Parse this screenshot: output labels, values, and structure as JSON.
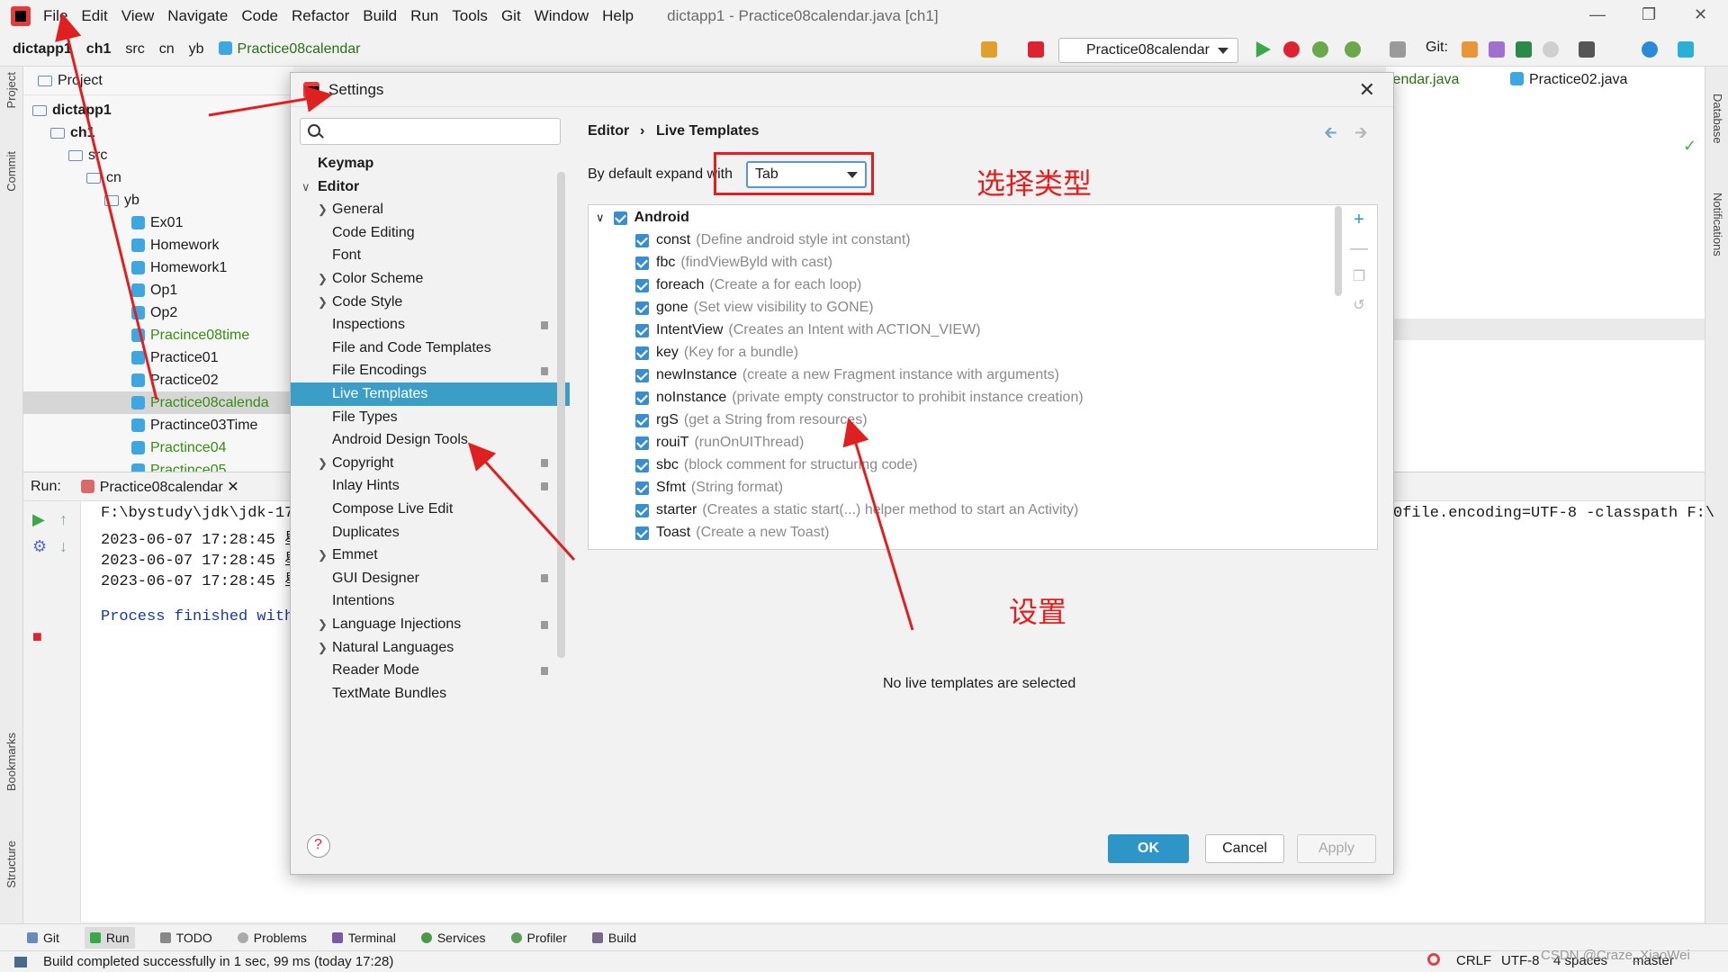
{
  "menubar": {
    "items": [
      "File",
      "Edit",
      "View",
      "Navigate",
      "Code",
      "Refactor",
      "Build",
      "Run",
      "Tools",
      "Git",
      "Window",
      "Help"
    ],
    "title": "dictapp1 - Practice08calendar.java [ch1]"
  },
  "navbar": {
    "crumbs": [
      "dictapp1",
      "ch1",
      "src",
      "cn",
      "yb"
    ],
    "file": "Practice08calendar",
    "run_config": "Practice08calendar",
    "git_label": "Git:"
  },
  "editor_tabs": {
    "tab1": "lendar.java",
    "tab2": "Practice02.java"
  },
  "side_labels": {
    "project": "Project",
    "commit": "Commit",
    "bookmarks": "Bookmarks",
    "structure": "Structure",
    "database": "Database",
    "notifications": "Notifications"
  },
  "project": {
    "header": "Project",
    "tree": [
      {
        "label": "dictapp1",
        "kind": "folder",
        "bold": true
      },
      {
        "label": "ch1",
        "kind": "folder",
        "bold": true
      },
      {
        "label": "src",
        "kind": "folder"
      },
      {
        "label": "cn",
        "kind": "folder"
      },
      {
        "label": "yb",
        "kind": "folder"
      },
      {
        "label": "Ex01",
        "kind": "class"
      },
      {
        "label": "Homework",
        "kind": "class"
      },
      {
        "label": "Homework1",
        "kind": "class"
      },
      {
        "label": "Op1",
        "kind": "class"
      },
      {
        "label": "Op2",
        "kind": "class"
      },
      {
        "label": "Pracince08time",
        "kind": "class",
        "green": true
      },
      {
        "label": "Practice01",
        "kind": "class"
      },
      {
        "label": "Practice02",
        "kind": "class"
      },
      {
        "label": "Practice08calenda",
        "kind": "class",
        "green": true
      },
      {
        "label": "Practince03Time",
        "kind": "class"
      },
      {
        "label": "Practince04",
        "kind": "class",
        "green": true
      },
      {
        "label": "Practince05",
        "kind": "class",
        "green": true
      }
    ]
  },
  "run": {
    "label": "Run:",
    "tab": "Practice08calendar",
    "lines": [
      "F:\\bystudy\\jdk\\jdk-17",
      "2023-06-07 17:28:45 星",
      "2023-06-07 17:28:45 星",
      "2023-06-07 17:28:45 星",
      "",
      "Process finished with"
    ],
    "right_line": "0file.encoding=UTF-8 -classpath F:\\"
  },
  "bottom_tabs": [
    "Git",
    "Run",
    "TODO",
    "Problems",
    "Terminal",
    "Services",
    "Profiler",
    "Build"
  ],
  "status": {
    "message": "Build completed successfully in 1 sec, 99 ms (today 17:28)",
    "line_sep": "CRLF",
    "encoding": "UTF-8",
    "indent": "4 spaces",
    "branch": "master",
    "watermark": "CSDN @Craze_XiaoWei"
  },
  "dialog": {
    "title": "Settings",
    "breadcrumb_parent": "Editor",
    "breadcrumb_sep": "›",
    "breadcrumb_current": "Live Templates",
    "expand_label": "By default expand with",
    "expand_value": "Tab",
    "no_selection": "No live templates are selected",
    "ok": "OK",
    "cancel": "Cancel",
    "apply": "Apply"
  },
  "settings_nav": [
    {
      "label": "Keymap",
      "level": 0,
      "bold": true
    },
    {
      "label": "Editor",
      "level": 0,
      "bold": true,
      "expanded": true
    },
    {
      "label": "General",
      "level": 1,
      "chevron": true
    },
    {
      "label": "Code Editing",
      "level": 1
    },
    {
      "label": "Font",
      "level": 1
    },
    {
      "label": "Color Scheme",
      "level": 1,
      "chevron": true
    },
    {
      "label": "Code Style",
      "level": 1,
      "chevron": true
    },
    {
      "label": "Inspections",
      "level": 1,
      "badge": true
    },
    {
      "label": "File and Code Templates",
      "level": 1
    },
    {
      "label": "File Encodings",
      "level": 1,
      "badge": true
    },
    {
      "label": "Live Templates",
      "level": 1,
      "selected": true
    },
    {
      "label": "File Types",
      "level": 1
    },
    {
      "label": "Android Design Tools",
      "level": 1
    },
    {
      "label": "Copyright",
      "level": 1,
      "chevron": true,
      "badge": true
    },
    {
      "label": "Inlay Hints",
      "level": 1,
      "badge": true
    },
    {
      "label": "Compose Live Edit",
      "level": 1
    },
    {
      "label": "Duplicates",
      "level": 1
    },
    {
      "label": "Emmet",
      "level": 1,
      "chevron": true
    },
    {
      "label": "GUI Designer",
      "level": 1,
      "badge": true
    },
    {
      "label": "Intentions",
      "level": 1
    },
    {
      "label": "Language Injections",
      "level": 1,
      "chevron": true,
      "badge": true
    },
    {
      "label": "Natural Languages",
      "level": 1,
      "chevron": true
    },
    {
      "label": "Reader Mode",
      "level": 1,
      "badge": true
    },
    {
      "label": "TextMate Bundles",
      "level": 1
    }
  ],
  "templates": {
    "group": "Android",
    "items": [
      {
        "name": "const",
        "desc": "(Define android style int constant)"
      },
      {
        "name": "fbc",
        "desc": "(findViewByld with cast)"
      },
      {
        "name": "foreach",
        "desc": "(Create a for each loop)"
      },
      {
        "name": "gone",
        "desc": "(Set view visibility to GONE)"
      },
      {
        "name": "IntentView",
        "desc": "(Creates an Intent with ACTION_VIEW)"
      },
      {
        "name": "key",
        "desc": "(Key for a bundle)"
      },
      {
        "name": "newInstance",
        "desc": "(create a new Fragment instance with arguments)"
      },
      {
        "name": "noInstance",
        "desc": "(private empty constructor to prohibit instance creation)"
      },
      {
        "name": "rgS",
        "desc": "(get a String from resources)"
      },
      {
        "name": "rouiT",
        "desc": "(runOnUIThread)"
      },
      {
        "name": "sbc",
        "desc": "(block comment for structuring code)"
      },
      {
        "name": "Sfmt",
        "desc": "(String format)"
      },
      {
        "name": "starter",
        "desc": "(Creates a static start(...) helper method to start an Activity)"
      },
      {
        "name": "Toast",
        "desc": "(Create a new Toast)"
      }
    ]
  },
  "annotations": {
    "choose_type": "选择类型",
    "settings": "设置"
  },
  "colors": {
    "accent": "#3a9ec6",
    "annotation": "#e02020",
    "ok_button": "#2e95c9",
    "checkbox": "#3a8ed0"
  }
}
